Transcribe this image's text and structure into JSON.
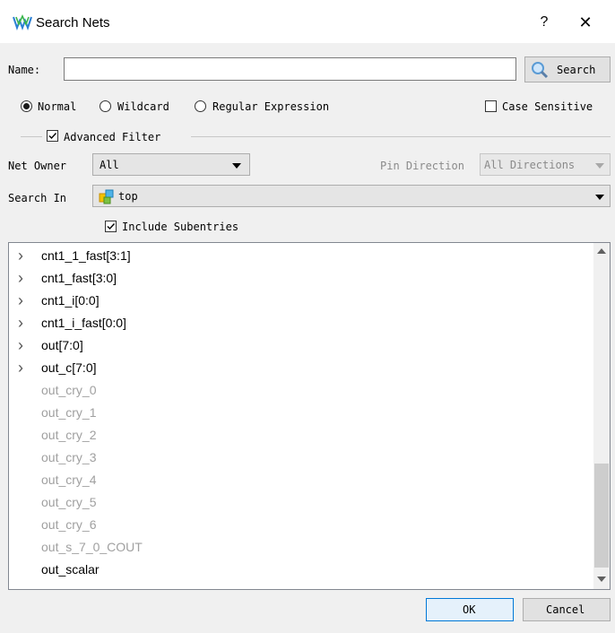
{
  "window": {
    "title": "Search Nets",
    "help": "?",
    "close": "✕"
  },
  "name_field": {
    "label": "Name:",
    "value": "",
    "search_button": "Search"
  },
  "modes": {
    "normal": "Normal",
    "wildcard": "Wildcard",
    "regex": "Regular Expression",
    "selected": "normal"
  },
  "case_sensitive": {
    "label": "Case Sensitive",
    "checked": false
  },
  "advanced_filter": {
    "label": "Advanced Filter",
    "checked": true
  },
  "net_owner": {
    "label": "Net Owner",
    "value": "All"
  },
  "pin_direction": {
    "label": "Pin Direction",
    "value": "All Directions"
  },
  "search_in": {
    "label": "Search In",
    "value": "top"
  },
  "include_subentries": {
    "label": "Include Subentries",
    "checked": true
  },
  "results": [
    {
      "label": "cnt1_1_fast[3:1]",
      "expandable": true,
      "dim": false
    },
    {
      "label": "cnt1_fast[3:0]",
      "expandable": true,
      "dim": false
    },
    {
      "label": "cnt1_i[0:0]",
      "expandable": true,
      "dim": false
    },
    {
      "label": "cnt1_i_fast[0:0]",
      "expandable": true,
      "dim": false
    },
    {
      "label": "out[7:0]",
      "expandable": true,
      "dim": false
    },
    {
      "label": "out_c[7:0]",
      "expandable": true,
      "dim": false
    },
    {
      "label": "out_cry_0",
      "expandable": false,
      "dim": true
    },
    {
      "label": "out_cry_1",
      "expandable": false,
      "dim": true
    },
    {
      "label": "out_cry_2",
      "expandable": false,
      "dim": true
    },
    {
      "label": "out_cry_3",
      "expandable": false,
      "dim": true
    },
    {
      "label": "out_cry_4",
      "expandable": false,
      "dim": true
    },
    {
      "label": "out_cry_5",
      "expandable": false,
      "dim": true
    },
    {
      "label": "out_cry_6",
      "expandable": false,
      "dim": true
    },
    {
      "label": "out_s_7_0_COUT",
      "expandable": false,
      "dim": true
    },
    {
      "label": "out_scalar",
      "expandable": false,
      "dim": false
    }
  ],
  "buttons": {
    "ok": "OK",
    "cancel": "Cancel"
  }
}
